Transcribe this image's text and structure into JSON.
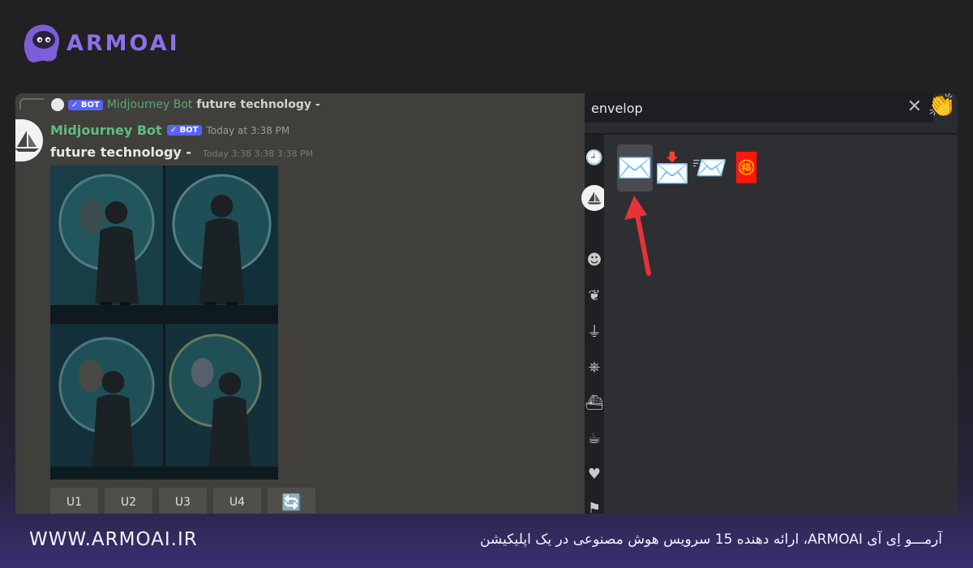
{
  "brand": {
    "name": "ARMOAI",
    "accent": "#8d6fe8"
  },
  "chat": {
    "reply": {
      "badge": "✓ BOT",
      "name": "Midjourney Bot",
      "text": "future technology -"
    },
    "author": "Midjourney Bot",
    "badge": "✓ BOT",
    "time": "Today at 3:38 PM",
    "message": "future technology -",
    "ghost_time": "Today 3:38 3:38 3:38 PM",
    "image_alt": "4-image grid: child facing astronaut helmet reflection",
    "buttons": [
      "U1",
      "U2",
      "U3",
      "U4"
    ],
    "refresh_icon": "refresh-icon"
  },
  "picker": {
    "search_value": "envelop",
    "clear_icon": "close-icon",
    "tone_emoji": "👏",
    "categories": [
      "clock-icon",
      "server-avatar",
      "smile-icon",
      "leaf-icon",
      "ice-cream-icon",
      "gamepad-icon",
      "ship-icon",
      "mug-icon",
      "heart-icon",
      "flag-icon"
    ],
    "results": [
      "✉️",
      "📩",
      "📨",
      "🧧"
    ],
    "selected_index": 0
  },
  "footer": {
    "url": "WWW.ARMOAI.IR",
    "caption": "آرمـــو اِی آی ARMOAI، ارائه دهنده 15 سرویس هوش مصنوعی در یک اپلیکیشن"
  }
}
